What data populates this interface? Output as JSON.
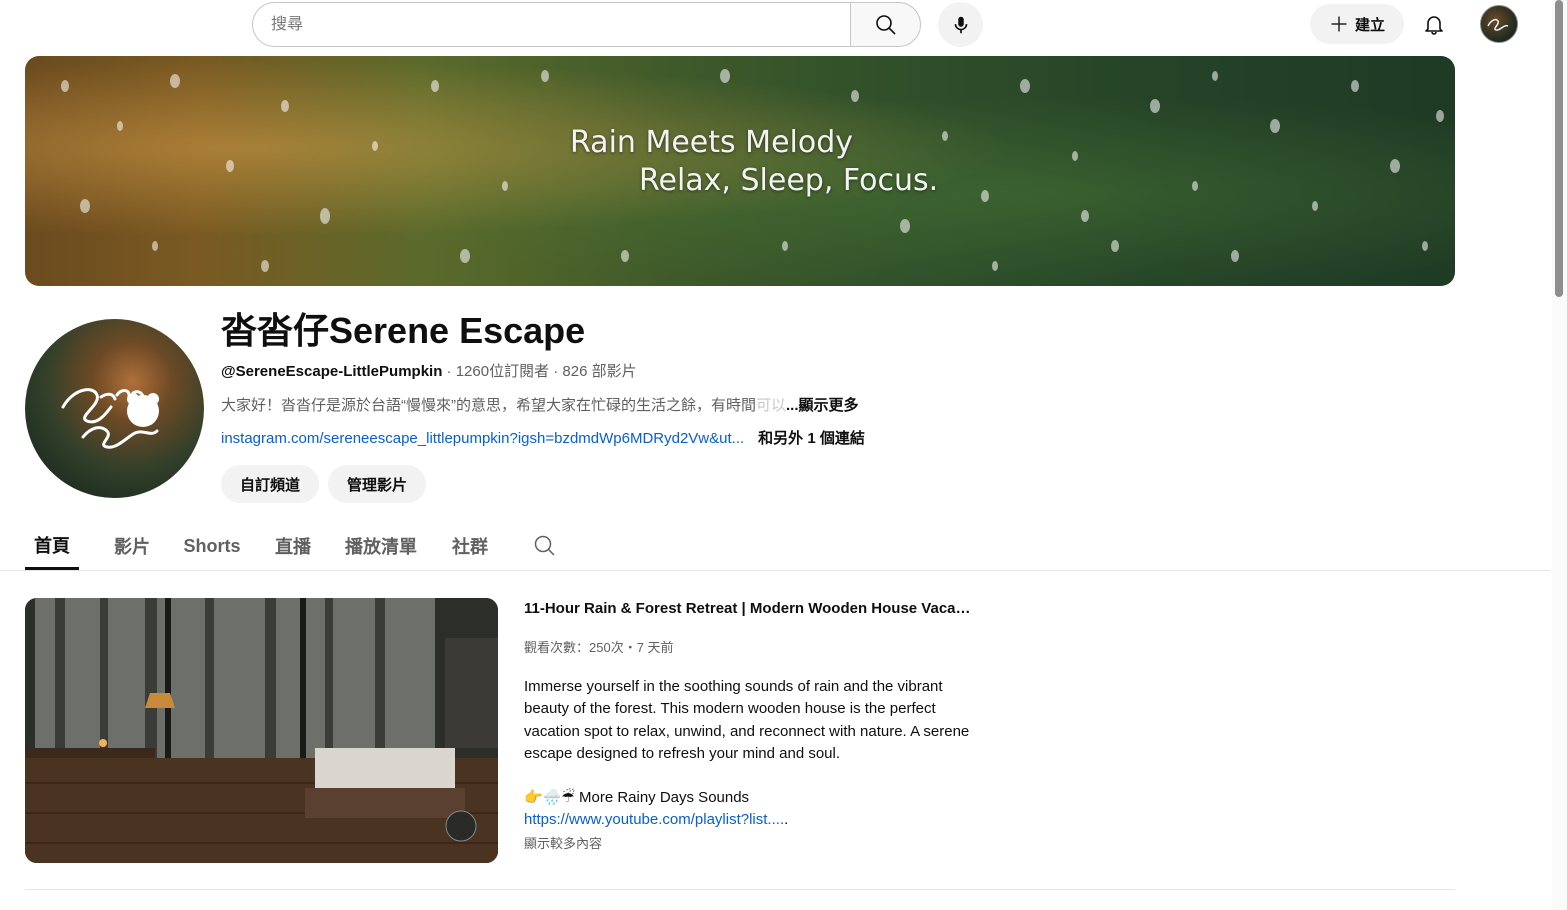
{
  "search": {
    "placeholder": "搜尋"
  },
  "topbar": {
    "create_label": "建立"
  },
  "banner": {
    "line1": "Rain Meets Melody",
    "line2": "Relax, Sleep, Focus."
  },
  "channel": {
    "name": "沓沓仔Serene Escape",
    "handle": "@SereneEscape-LittlePumpkin",
    "stats": " · 1260位訂閱者 · 826 部影片",
    "description": "大家好！沓沓仔是源於台語“慢慢來”的意思，希望大家在忙碌的生活之餘，有時間",
    "description_fade": "可以",
    "show_more": "...顯示更多",
    "link": "instagram.com/sereneescape_littlepumpkin?igsh=bzdmdWp6MDRyd2Vw&ut...",
    "other_links": "和另外 1 個連結",
    "customize_label": "自訂頻道",
    "manage_label": "管理影片"
  },
  "tabs": [
    "首頁",
    "影片",
    "Shorts",
    "直播",
    "播放清單",
    "社群"
  ],
  "featured": {
    "title": "11-Hour Rain & Forest Retreat | Modern Wooden House Vacati...",
    "meta": "觀看次數：250次・7 天前",
    "description": "Immerse yourself in the soothing sounds of rain and the vibrant beauty of the forest. This modern wooden house is the perfect vacation spot to relax, unwind, and reconnect with nature. A serene escape designed to refresh your mind and soul.",
    "playlist_emoji": "👉🌧️☔",
    "playlist_title": "More Rainy Days Sounds",
    "link": "https://www.youtube.com/playlist?list....",
    "link_tail": ".",
    "show_more": "顯示較多內容"
  },
  "colors": {
    "link": "#065fd4",
    "text": "#0f0f0f",
    "secondary": "#606060",
    "pill": "#f2f2f2"
  }
}
